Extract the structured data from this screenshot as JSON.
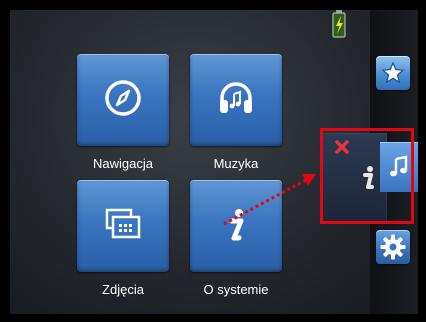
{
  "menu": {
    "tiles": [
      {
        "label": "Nawigacja",
        "icon": "compass-icon"
      },
      {
        "label": "Muzyka",
        "icon": "headphones-icon"
      },
      {
        "label": "Zdjęcia",
        "icon": "photos-icon"
      },
      {
        "label": "O systemie",
        "icon": "info-icon"
      }
    ]
  },
  "status": {
    "battery_icon": "battery-charging-icon"
  },
  "side_panel": {
    "favorites_icon": "star-icon",
    "settings_icon": "gear-icon",
    "popup": {
      "close_icon": "close-icon",
      "info_icon": "info-icon",
      "music_icon": "music-note-icon"
    }
  },
  "annotation": {
    "highlight_color": "#e30613",
    "arrow_color": "#e30613"
  },
  "colors": {
    "tile_blue": "#3a74c0",
    "background": "#24282e"
  }
}
